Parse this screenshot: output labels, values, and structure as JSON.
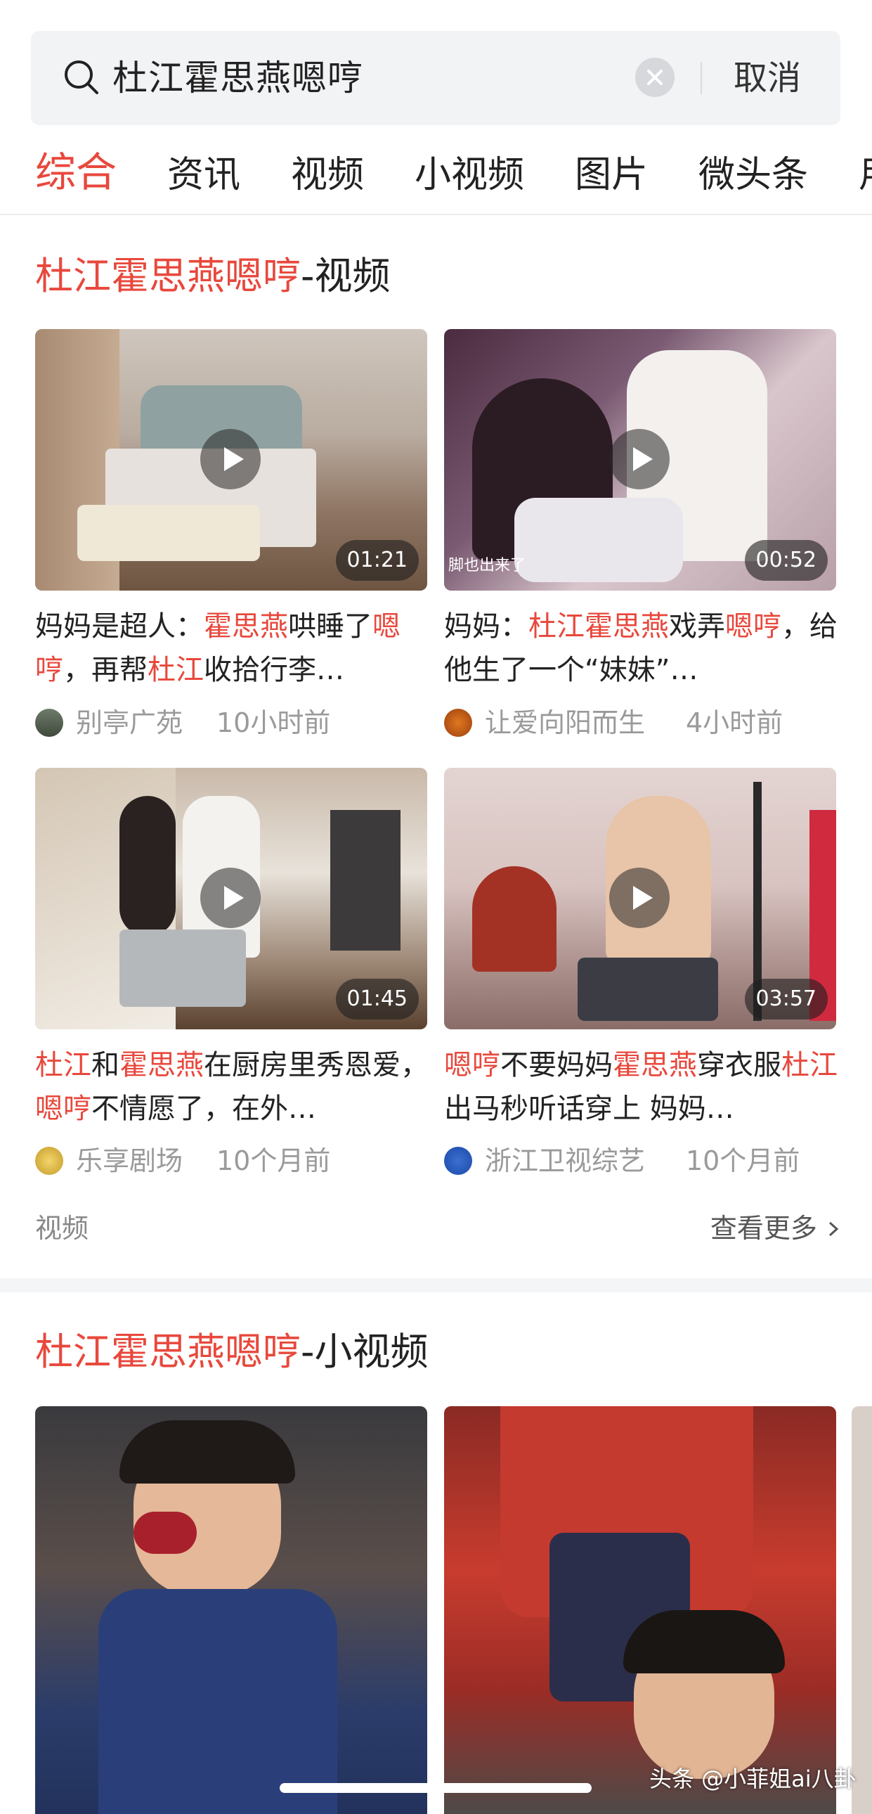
{
  "search": {
    "query": "杜江霍思燕嗯哼",
    "cancel_label": "取消"
  },
  "tabs": [
    {
      "label": "综合",
      "active": true
    },
    {
      "label": "资讯"
    },
    {
      "label": "视频"
    },
    {
      "label": "小视频"
    },
    {
      "label": "图片"
    },
    {
      "label": "微头条"
    },
    {
      "label": "用"
    }
  ],
  "video_section": {
    "title_highlight": "杜江霍思燕嗯哼",
    "title_suffix": "-视频",
    "cards": [
      {
        "duration": "01:21",
        "title_parts": [
          {
            "text": "妈妈是超人：",
            "hl": false
          },
          {
            "text": "霍思燕",
            "hl": true
          },
          {
            "text": "哄睡了",
            "hl": false
          },
          {
            "text": "嗯哼",
            "hl": true
          },
          {
            "text": "，再帮",
            "hl": false
          },
          {
            "text": "杜江",
            "hl": true
          },
          {
            "text": "收拾行李…",
            "hl": false
          }
        ],
        "source": "别亭广苑",
        "time": "10小时前"
      },
      {
        "duration": "00:52",
        "overlay": "脚也出来了",
        "title_parts": [
          {
            "text": "妈妈：",
            "hl": false
          },
          {
            "text": "杜江霍思燕",
            "hl": true
          },
          {
            "text": "戏弄",
            "hl": false
          },
          {
            "text": "嗯哼",
            "hl": true
          },
          {
            "text": "，给他生了一个“妹妹”…",
            "hl": false
          }
        ],
        "source": "让爱向阳而生",
        "time": "4小时前"
      },
      {
        "duration": "01:45",
        "title_parts": [
          {
            "text": "杜江",
            "hl": true
          },
          {
            "text": "和",
            "hl": false
          },
          {
            "text": "霍思燕",
            "hl": true
          },
          {
            "text": "在厨房里秀恩爱，",
            "hl": false
          },
          {
            "text": "嗯哼",
            "hl": true
          },
          {
            "text": "不情愿了，在外…",
            "hl": false
          }
        ],
        "source": "乐享剧场",
        "time": "10个月前"
      },
      {
        "duration": "03:57",
        "title_parts": [
          {
            "text": "嗯哼",
            "hl": true
          },
          {
            "text": "不要妈妈",
            "hl": false
          },
          {
            "text": "霍思燕",
            "hl": true
          },
          {
            "text": "穿衣服",
            "hl": false
          },
          {
            "text": "杜江",
            "hl": true
          },
          {
            "text": "出马秒听话穿上 妈妈…",
            "hl": false
          }
        ],
        "source": "浙江卫视综艺",
        "time": "10个月前"
      }
    ],
    "footer_label": "视频",
    "see_more_label": "查看更多"
  },
  "small_video_section": {
    "title_highlight": "杜江霍思燕嗯哼",
    "title_suffix": "-小视频"
  },
  "watermark": "头条 @小菲姐ai八卦",
  "colors": {
    "accent": "#e8483c",
    "text": "#222222",
    "meta": "#9a9a9a",
    "search_bg": "#f2f3f5"
  }
}
